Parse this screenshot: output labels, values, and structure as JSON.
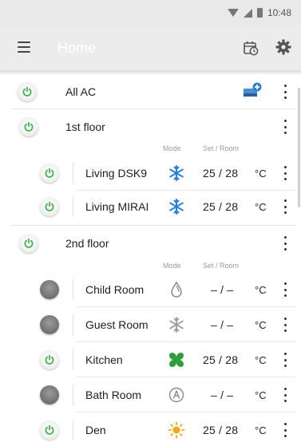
{
  "status_bar": {
    "time": "10:48",
    "icons": [
      "wifi-icon",
      "signal-icon",
      "battery-icon"
    ]
  },
  "app_bar": {
    "title": "Home",
    "icons": [
      "menu-icon",
      "schedule-icon",
      "gear-icon"
    ]
  },
  "colors": {
    "power_on": "#3bb54a",
    "cool_blue": "#2a7fd4",
    "fan_green": "#2e9e3c",
    "heat_orange": "#f5a51c",
    "off_grey": "#6d6d6d"
  },
  "column_headers": {
    "mode": "Mode",
    "set_room": "Set / Room"
  },
  "all_ac": {
    "label": "All AC",
    "icon": "add-schedule-icon"
  },
  "groups": [
    {
      "label": "1st floor",
      "units": [
        {
          "name": "Living DSK9",
          "power": "on",
          "mode": "cool",
          "set_room": "25 / 28",
          "unit": "°C"
        },
        {
          "name": "Living MIRAI",
          "power": "on",
          "mode": "cool",
          "set_room": "25 / 28",
          "unit": "°C"
        }
      ]
    },
    {
      "label": "2nd floor",
      "units": [
        {
          "name": "Child Room",
          "power": "off",
          "mode": "dry",
          "set_room": "– / –",
          "unit": "°C"
        },
        {
          "name": "Guest Room",
          "power": "off",
          "mode": "cool",
          "set_room": "– / –",
          "unit": "°C"
        },
        {
          "name": "Kitchen",
          "power": "on",
          "mode": "fan",
          "set_room": "25 / 28",
          "unit": "°C"
        },
        {
          "name": "Bath Room",
          "power": "off",
          "mode": "auto",
          "set_room": "– / –",
          "unit": "°C"
        },
        {
          "name": "Den",
          "power": "on",
          "mode": "heat",
          "set_room": "25 / 28",
          "unit": "°C"
        }
      ]
    }
  ]
}
